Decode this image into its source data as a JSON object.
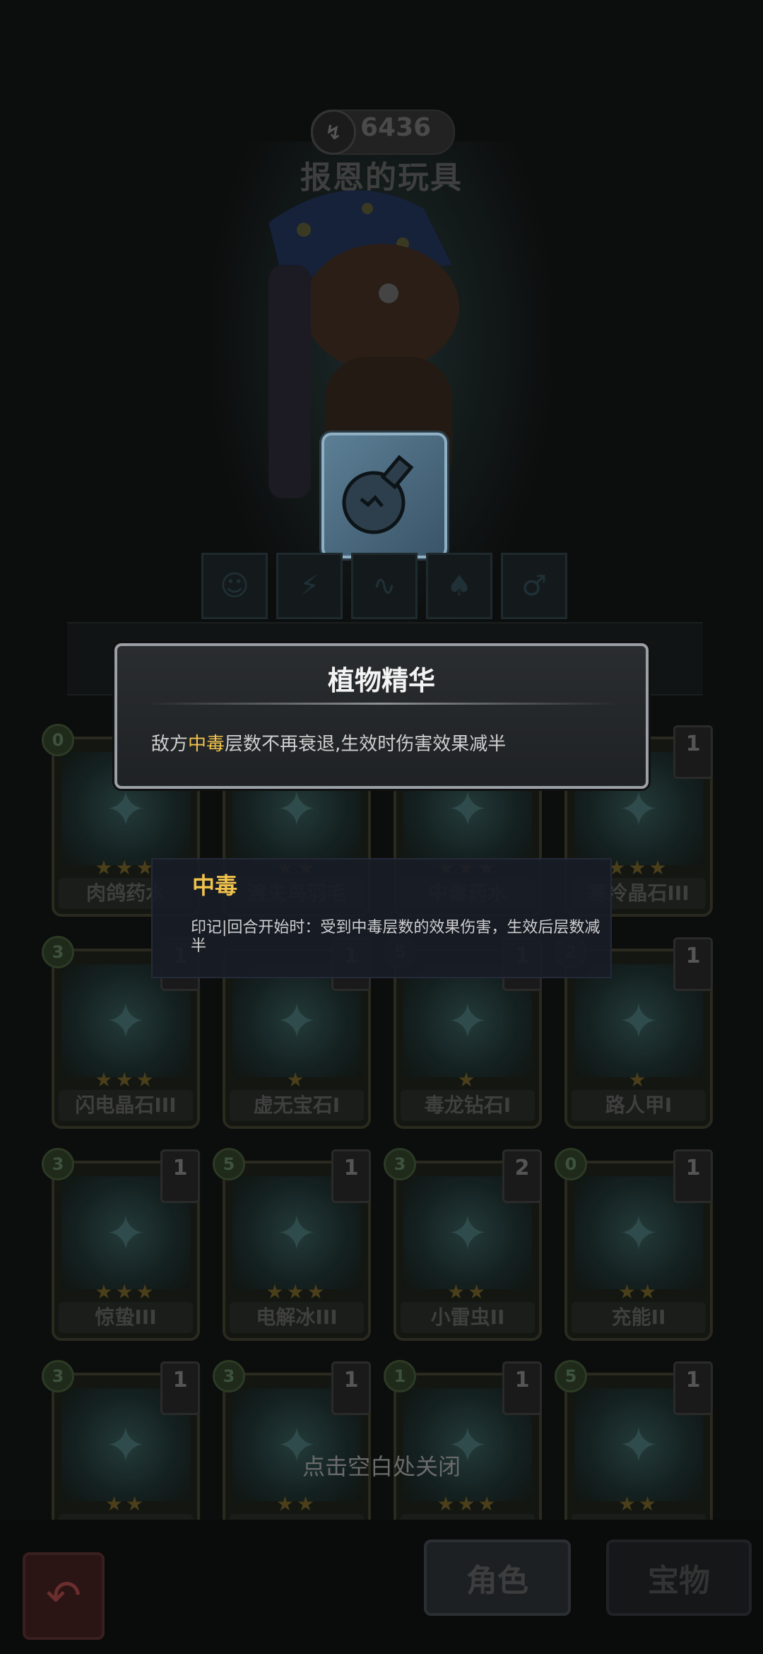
{
  "header": {
    "power": "6436",
    "character_name": "报恩的玩具"
  },
  "equipment_slots": [
    "slot-1",
    "slot-2",
    "slot-3",
    "slot-4",
    "slot-5"
  ],
  "modal": {
    "title": "植物精华",
    "desc_prefix": "敌方",
    "desc_keyword": "中毒",
    "desc_suffix": "层数不再衰退,生效时伤害效果减半"
  },
  "tooltip": {
    "title": "中毒",
    "desc": "印记|回合开始时：受到中毒层数的效果伤害，生效后层数减半"
  },
  "cards": [
    {
      "name": "肉鸽药水",
      "cost": "0",
      "level": "",
      "stars": "★★★"
    },
    {
      "name": "渡夫鸟羽毛",
      "cost": "",
      "level": "",
      "stars": "★★"
    },
    {
      "name": "中毒药水",
      "cost": "",
      "level": "",
      "stars": "★★★"
    },
    {
      "name": "寒冷晶石III",
      "cost": "",
      "level": "1",
      "stars": "★★★"
    },
    {
      "name": "闪电晶石III",
      "cost": "3",
      "level": "1",
      "stars": "★★★"
    },
    {
      "name": "虚无宝石I",
      "cost": "",
      "level": "1",
      "stars": "★"
    },
    {
      "name": "毒龙钻石I",
      "cost": "5",
      "level": "1",
      "stars": "★"
    },
    {
      "name": "路人甲I",
      "cost": "2",
      "level": "1",
      "stars": "★"
    },
    {
      "name": "惊蛰III",
      "cost": "3",
      "level": "1",
      "stars": "★★★"
    },
    {
      "name": "电解冰III",
      "cost": "5",
      "level": "1",
      "stars": "★★★"
    },
    {
      "name": "小雷虫II",
      "cost": "3",
      "level": "2",
      "stars": "★★"
    },
    {
      "name": "充能II",
      "cost": "0",
      "level": "1",
      "stars": "★★"
    },
    {
      "name": "",
      "cost": "3",
      "level": "1",
      "stars": "★★"
    },
    {
      "name": "",
      "cost": "3",
      "level": "1",
      "stars": "★★"
    },
    {
      "name": "",
      "cost": "1",
      "level": "1",
      "stars": "★★★"
    },
    {
      "name": "",
      "cost": "5",
      "level": "1",
      "stars": "★★"
    }
  ],
  "close_hint": "点击空白处关闭",
  "bottom_nav": {
    "back_icon": "back-arrow-icon",
    "tab_role": "角色",
    "tab_treasure": "宝物"
  },
  "colors": {
    "highlight": "#f1c24c",
    "modal_border": "#9aa0a6"
  }
}
